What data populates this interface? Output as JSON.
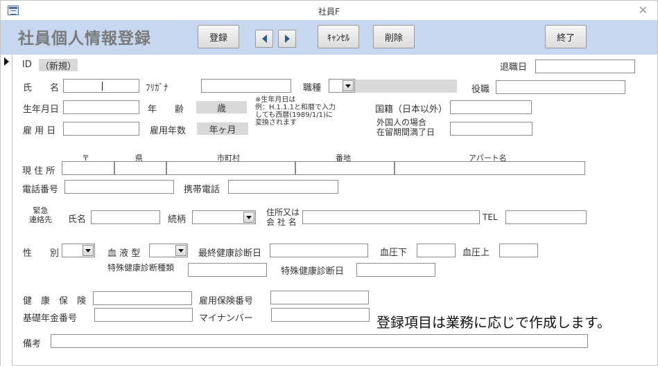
{
  "window": {
    "title": "社員F"
  },
  "header": {
    "form_title": "社員個人情報登録",
    "buttons": {
      "register": "登録",
      "cancel": "ｷｬﾝｾﾙ",
      "delete": "削除",
      "exit": "終了"
    }
  },
  "record": {
    "id_label": "ID",
    "id_value": "（新規）",
    "retire_label": "退職日"
  },
  "labels": {
    "name": "氏　　名",
    "furigana": "ﾌﾘｶﾞﾅ",
    "job": "職種",
    "position": "役職",
    "birth": "生年月日",
    "age": "年　　齢",
    "age_value": "歳",
    "hire": "雇 用 日",
    "years": "雇用年数",
    "years_value": "年ヶ月",
    "note_line1": "※生年月日は",
    "note_line2": "例：H.1.1.1と和暦で入力",
    "note_line3": "しても西暦(1989/1/1)に",
    "note_line4": "変換されます",
    "nationality": "国籍（日本以外）",
    "foreign_line1": "外国人の場合",
    "foreign_line2": "在留期間満了日",
    "addr_postal": "〒",
    "addr_pref": "県",
    "addr_city": "市町村",
    "addr_number": "番地",
    "addr_apt": "アパート名",
    "address": "現 住 所",
    "phone": "電話番号",
    "mobile": "携帯電話",
    "emergency_line1": "緊急",
    "emergency_line2": "連絡先",
    "em_name": "氏名",
    "relation": "続柄",
    "em_addr_line1": "住所又は",
    "em_addr_line2": "会 社 名",
    "tel": "TEL",
    "gender": "性　　別",
    "blood": "血 液 型",
    "last_checkup": "最終健康診断日",
    "bp_low": "血圧下",
    "bp_high": "血圧上",
    "special_type": "特殊健康診断種類",
    "special_date": "特殊健康診断日",
    "health_ins": "健　康　保　険",
    "emp_ins": "雇用保険番号",
    "pension": "基礎年金番号",
    "mynumber": "マイナンバー",
    "remarks": "備考"
  },
  "notice": "登録項目は業務に応じで作成します。",
  "colors": {
    "header_bg": "#c7d7f0",
    "field_gray": "#d9d9d9",
    "nav_arrow": "#2a5a9a"
  },
  "icons": [
    "app-form-icon",
    "close-icon",
    "prev-record-icon",
    "next-record-icon",
    "record-selector-arrow-icon",
    "dropdown-arrow-icon"
  ]
}
